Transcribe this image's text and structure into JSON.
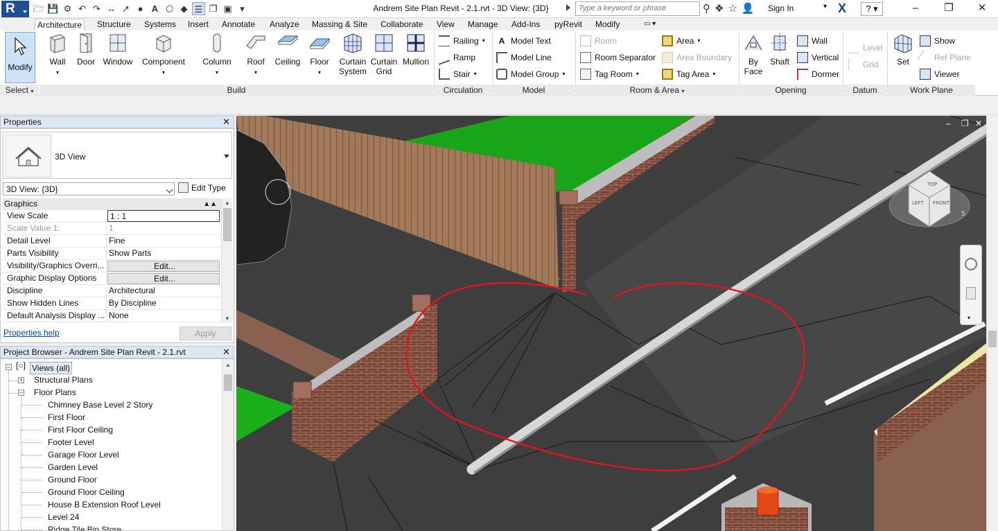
{
  "titlebar": {
    "app_letter": "R",
    "title": "Andrem Site Plan Revit - 2.1.rvt - 3D View: {3D}",
    "search_placeholder": "Type a keyword or phrase",
    "sign_in": "Sign In",
    "help": "?"
  },
  "ribbon": {
    "tabs": [
      "Architecture",
      "Structure",
      "Systems",
      "Insert",
      "Annotate",
      "Analyze",
      "Massing & Site",
      "Collaborate",
      "View",
      "Manage",
      "Add-Ins",
      "pyRevit",
      "Modify"
    ],
    "modify_label": "Modify",
    "build": {
      "wall": "Wall",
      "door": "Door",
      "window": "Window",
      "component": "Component",
      "column": "Column",
      "roof": "Roof",
      "ceiling": "Ceiling",
      "floor": "Floor",
      "curtain_system": [
        "Curtain",
        "System"
      ],
      "curtain_grid": [
        "Curtain",
        "Grid"
      ],
      "mullion": "Mullion"
    },
    "circulation": {
      "railing": "Railing",
      "ramp": "Ramp",
      "stair": "Stair"
    },
    "model": {
      "model_text": "Model  Text",
      "model_line": "Model  Line",
      "model_group": "Model  Group"
    },
    "room_area": {
      "room": "Room",
      "room_separator": "Room  Separator",
      "tag_room": "Tag  Room",
      "area": "Area",
      "area_boundary": "Area  Boundary",
      "tag_area": "Tag  Area"
    },
    "opening": {
      "by_face": [
        "By",
        "Face"
      ],
      "shaft": "Shaft",
      "wall": "Wall",
      "vertical": "Vertical",
      "dormer": "Dormer"
    },
    "datum": {
      "level": "Level",
      "grid": "Grid"
    },
    "work_plane": {
      "set": "Set",
      "show": "Show",
      "ref_plane": "Ref  Plane",
      "viewer": "Viewer"
    },
    "panel_labels": {
      "select": "Select",
      "build": "Build",
      "circulation": "Circulation",
      "model": "Model",
      "room_area": "Room & Area",
      "opening": "Opening",
      "datum": "Datum",
      "work_plane": "Work Plane"
    }
  },
  "properties": {
    "header": "Properties",
    "type_name": "3D View",
    "instance": "3D View: {3D}",
    "edit_type": "Edit Type",
    "group": "Graphics",
    "rows": [
      {
        "k": "View Scale",
        "v": "1 : 1"
      },
      {
        "k": "Scale Value    1:",
        "v": "1"
      },
      {
        "k": "Detail Level",
        "v": "Fine"
      },
      {
        "k": "Parts Visibility",
        "v": "Show Parts"
      },
      {
        "k": "Visibility/Graphics Overri...",
        "v": "Edit..."
      },
      {
        "k": "Graphic Display Options",
        "v": "Edit..."
      },
      {
        "k": "Discipline",
        "v": "Architectural"
      },
      {
        "k": "Show Hidden Lines",
        "v": "By Discipline"
      },
      {
        "k": "Default Analysis Display ...",
        "v": "None"
      }
    ],
    "help_link": "Properties help",
    "apply": "Apply"
  },
  "browser": {
    "header": "Project Browser - Andrem Site Plan Revit - 2.1.rvt",
    "views_all": "Views (all)",
    "structural_plans": "Structural Plans",
    "floor_plans": "Floor Plans",
    "items": [
      "Chimney Base Level 2 Story",
      "First Floor",
      "First Floor Ceiling",
      "Footer Level",
      "Garage Floor Level",
      "Garden Level",
      "Ground Floor",
      "Ground Floor Ceiling",
      "House B Extension Roof Level",
      "Level 24",
      "Ridge Tile Bin Store"
    ]
  },
  "viewcube": {
    "top": "TOP",
    "left": "LEFT",
    "front": "FRONT",
    "compass_s": "S"
  },
  "colors": {
    "accent": "#1c4f96",
    "lawn": "#19a519",
    "asphalt": "#3e3e3e",
    "brick": "#7a4434",
    "markup": "#e0161b"
  }
}
